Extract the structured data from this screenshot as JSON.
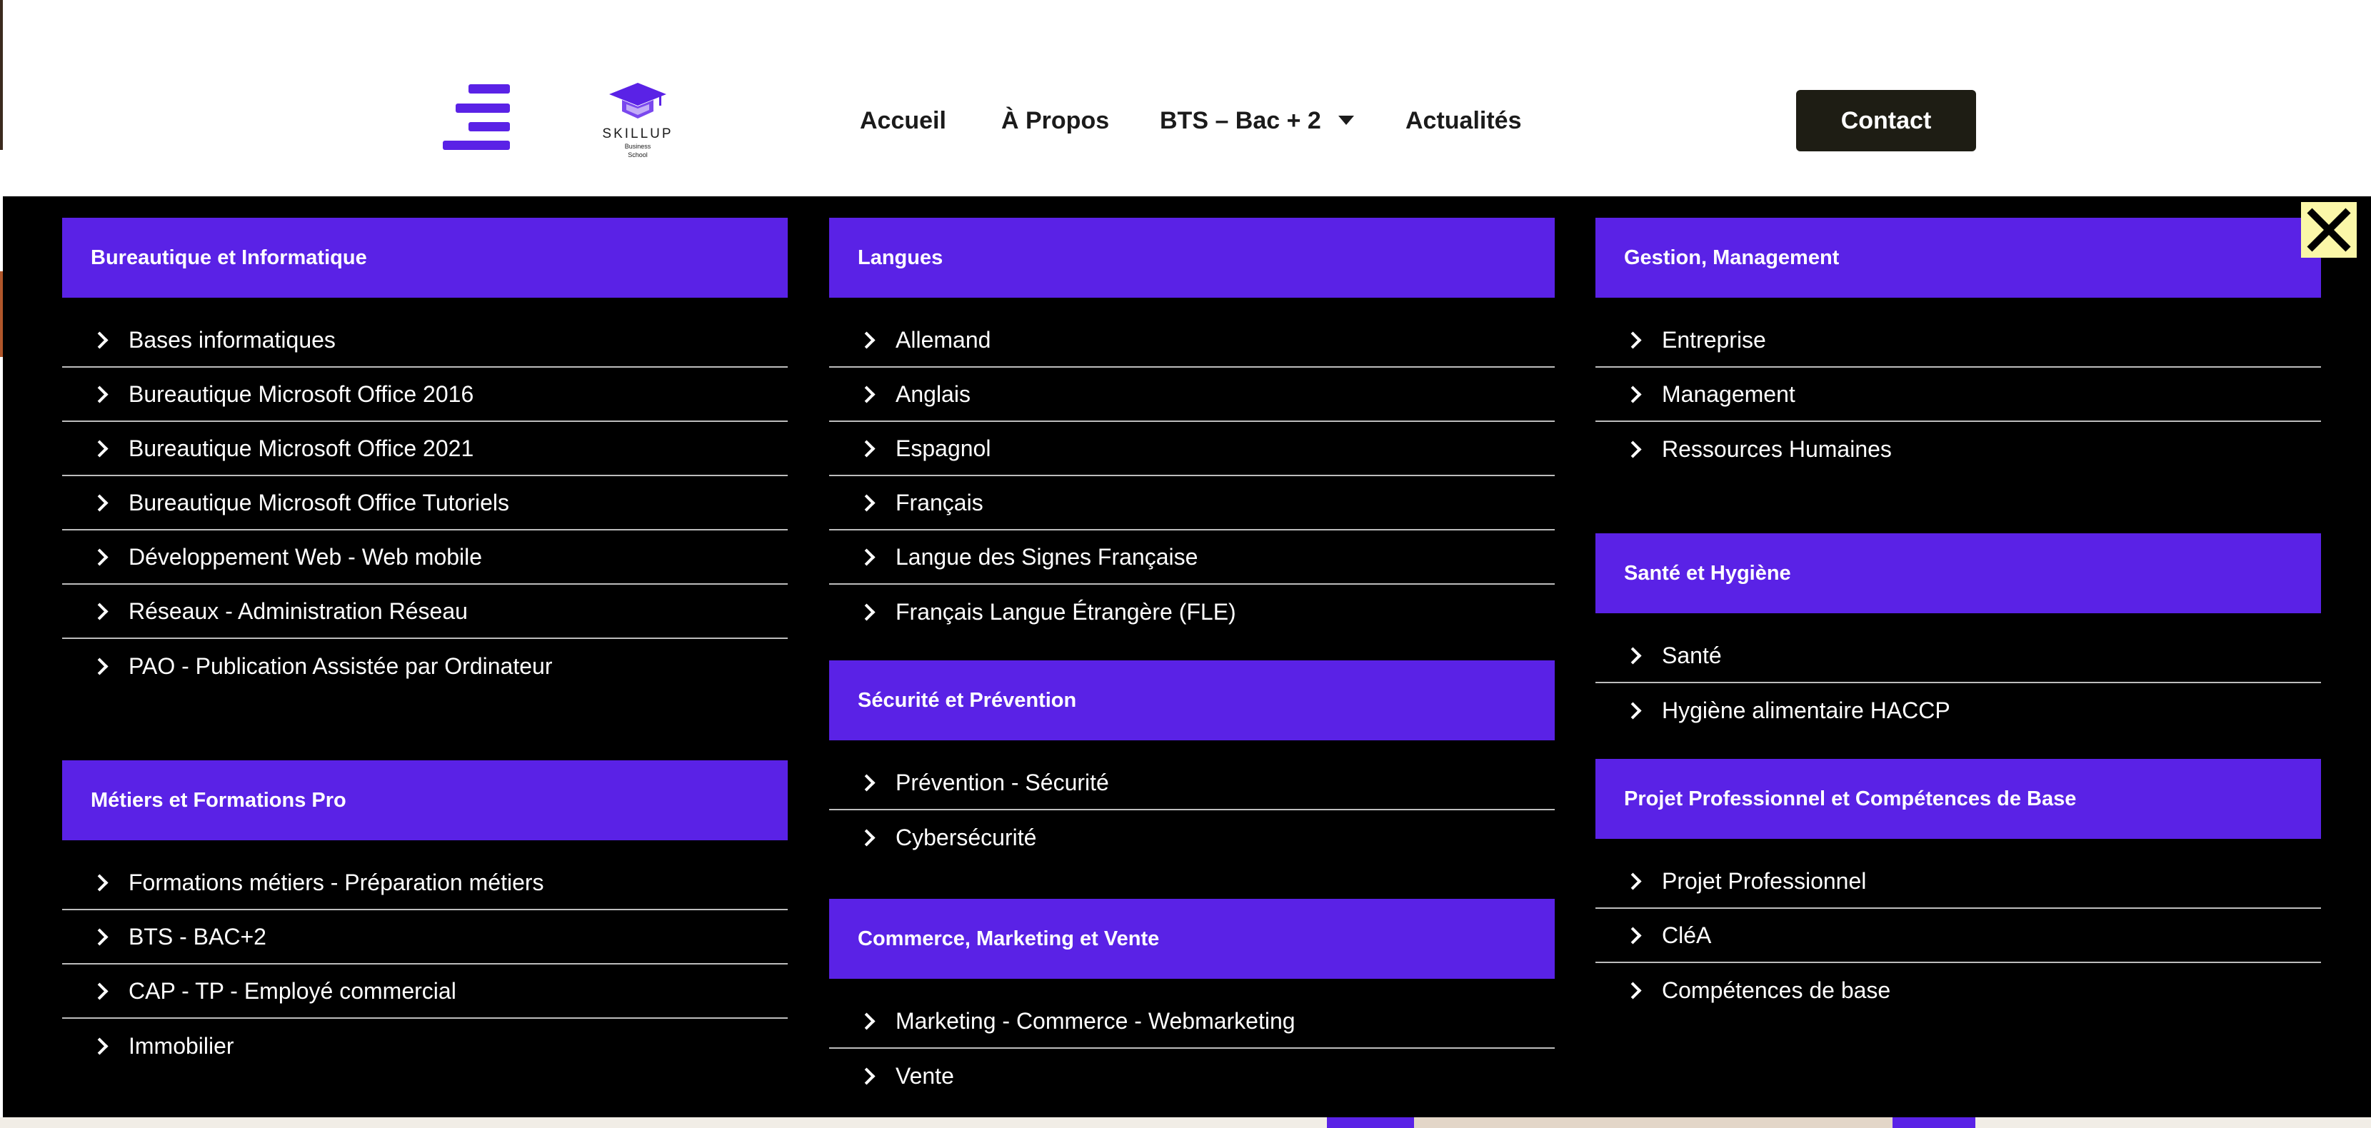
{
  "header": {
    "logo": {
      "name": "SKILLUP",
      "sub1": "Business",
      "sub2": "School"
    },
    "nav": [
      {
        "label": "Accueil"
      },
      {
        "label": "À Propos"
      },
      {
        "label": "BTS – Bac + 2"
      },
      {
        "label": "Actualités"
      }
    ],
    "contact_label": "Contact"
  },
  "colors": {
    "accent": "#5a22e6",
    "menu_bg": "#000000",
    "close_bg": "#fbf7a8",
    "contact_bg": "#1e1d14"
  },
  "icons": {
    "menu": "hamburger-menu-icon",
    "close": "close-icon",
    "item": "chevron-right-icon",
    "dropdown": "caret-down-icon"
  },
  "menu": {
    "col1": [
      {
        "title": "Bureautique et Informatique",
        "items": [
          "Bases informatiques",
          "Bureautique Microsoft Office 2016",
          "Bureautique Microsoft Office 2021",
          "Bureautique Microsoft Office Tutoriels",
          "Développement Web - Web mobile",
          "Réseaux - Administration Réseau",
          "PAO - Publication Assistée par Ordinateur"
        ]
      },
      {
        "title": "Métiers et Formations Pro",
        "items": [
          "Formations métiers - Préparation métiers",
          "BTS - BAC+2",
          "CAP - TP - Employé commercial",
          "Immobilier"
        ]
      }
    ],
    "col2": [
      {
        "title": "Langues",
        "items": [
          "Allemand",
          "Anglais",
          "Espagnol",
          "Français",
          "Langue des Signes Française",
          "Français Langue Étrangère (FLE)"
        ]
      },
      {
        "title": "Sécurité et Prévention",
        "items": [
          "Prévention - Sécurité",
          "Cybersécurité"
        ]
      },
      {
        "title": "Commerce, Marketing et Vente",
        "items": [
          "Marketing - Commerce - Webmarketing",
          "Vente"
        ]
      }
    ],
    "col3": [
      {
        "title": "Gestion, Management",
        "items": [
          "Entreprise",
          "Management",
          "Ressources Humaines"
        ]
      },
      {
        "title": "Santé et Hygiène",
        "items": [
          "Santé",
          "Hygiène alimentaire HACCP"
        ]
      },
      {
        "title": "Projet Professionnel et Compétences de Base",
        "items": [
          "Projet Professionnel",
          "CléA",
          "Compétences de base"
        ]
      }
    ]
  }
}
